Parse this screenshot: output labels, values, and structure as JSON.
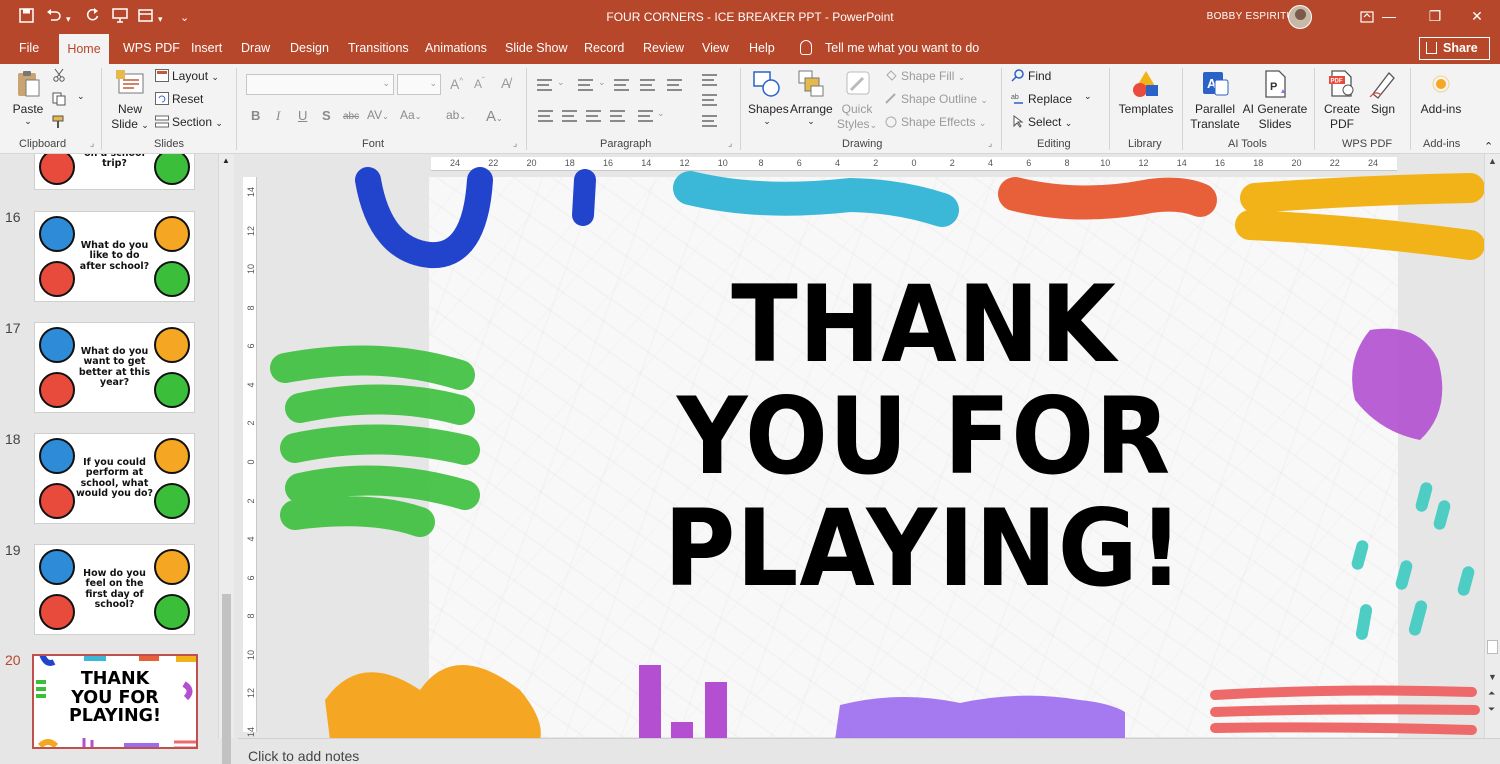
{
  "app": {
    "doc_title": "FOUR CORNERS - ICE BREAKER PPT",
    "app_name": "PowerPoint",
    "user_name": "BOBBY ESPIRITU",
    "accent": "#b7472a"
  },
  "tabs": [
    "File",
    "Home",
    "WPS PDF",
    "Insert",
    "Draw",
    "Design",
    "Transitions",
    "Animations",
    "Slide Show",
    "Record",
    "Review",
    "View",
    "Help"
  ],
  "tell_me": "Tell me what you want to do",
  "share_label": "Share",
  "ribbon": {
    "clipboard": {
      "label": "Clipboard",
      "paste": "Paste"
    },
    "slides": {
      "label": "Slides",
      "new_slide_1": "New",
      "new_slide_2": "Slide",
      "layout": "Layout",
      "reset": "Reset",
      "section": "Section"
    },
    "font": {
      "label": "Font"
    },
    "paragraph": {
      "label": "Paragraph"
    },
    "drawing": {
      "label": "Drawing",
      "shapes": "Shapes",
      "arrange": "Arrange",
      "quick_styles_1": "Quick",
      "quick_styles_2": "Styles",
      "shape_fill": "Shape Fill",
      "shape_outline": "Shape Outline",
      "shape_effects": "Shape Effects"
    },
    "editing": {
      "label": "Editing",
      "find": "Find",
      "replace": "Replace",
      "select": "Select"
    },
    "library": {
      "label": "Library",
      "templates": "Templates"
    },
    "ai_tools": {
      "label": "AI Tools",
      "parallel_1": "Parallel",
      "parallel_2": "Translate",
      "ai_gen_1": "AI Generate",
      "ai_gen_2": "Slides"
    },
    "wps_pdf": {
      "label": "WPS PDF",
      "create_1": "Create",
      "create_2": "PDF",
      "sign": "Sign"
    },
    "addins": {
      "label": "Add-ins",
      "addins": "Add-ins"
    }
  },
  "slides": [
    {
      "num": "",
      "question": "on a school trip?"
    },
    {
      "num": "16",
      "question": "What do you like to do after school?"
    },
    {
      "num": "17",
      "question": "What do you want to get better at this year?"
    },
    {
      "num": "18",
      "question": "If you could perform at school, what would you do?"
    },
    {
      "num": "19",
      "question": "How do you feel on the first day of school?"
    },
    {
      "num": "20",
      "question": "THANK YOU FOR PLAYING!"
    }
  ],
  "slide_main": {
    "title": "THANK YOU FOR PLAYING!"
  },
  "ruler_h": [
    "24",
    "22",
    "20",
    "18",
    "16",
    "14",
    "12",
    "10",
    "8",
    "6",
    "4",
    "2",
    "0",
    "2",
    "4",
    "6",
    "8",
    "10",
    "12",
    "14",
    "16",
    "18",
    "20",
    "22",
    "24"
  ],
  "ruler_v": [
    "14",
    "12",
    "10",
    "8",
    "6",
    "4",
    "2",
    "0",
    "2",
    "4",
    "6",
    "8",
    "10",
    "12",
    "14"
  ],
  "notes_placeholder": "Click to add notes",
  "colors": {
    "blue": "#2244cc",
    "cyan": "#3bb8d8",
    "orange": "#e8603a",
    "yellow": "#f2b318",
    "green": "#3bbf3b",
    "purple": "#b34fd0",
    "teal": "#4ecdc4",
    "amber": "#f5a623",
    "violet": "#9b6cf0",
    "coral": "#ee6a6a"
  }
}
